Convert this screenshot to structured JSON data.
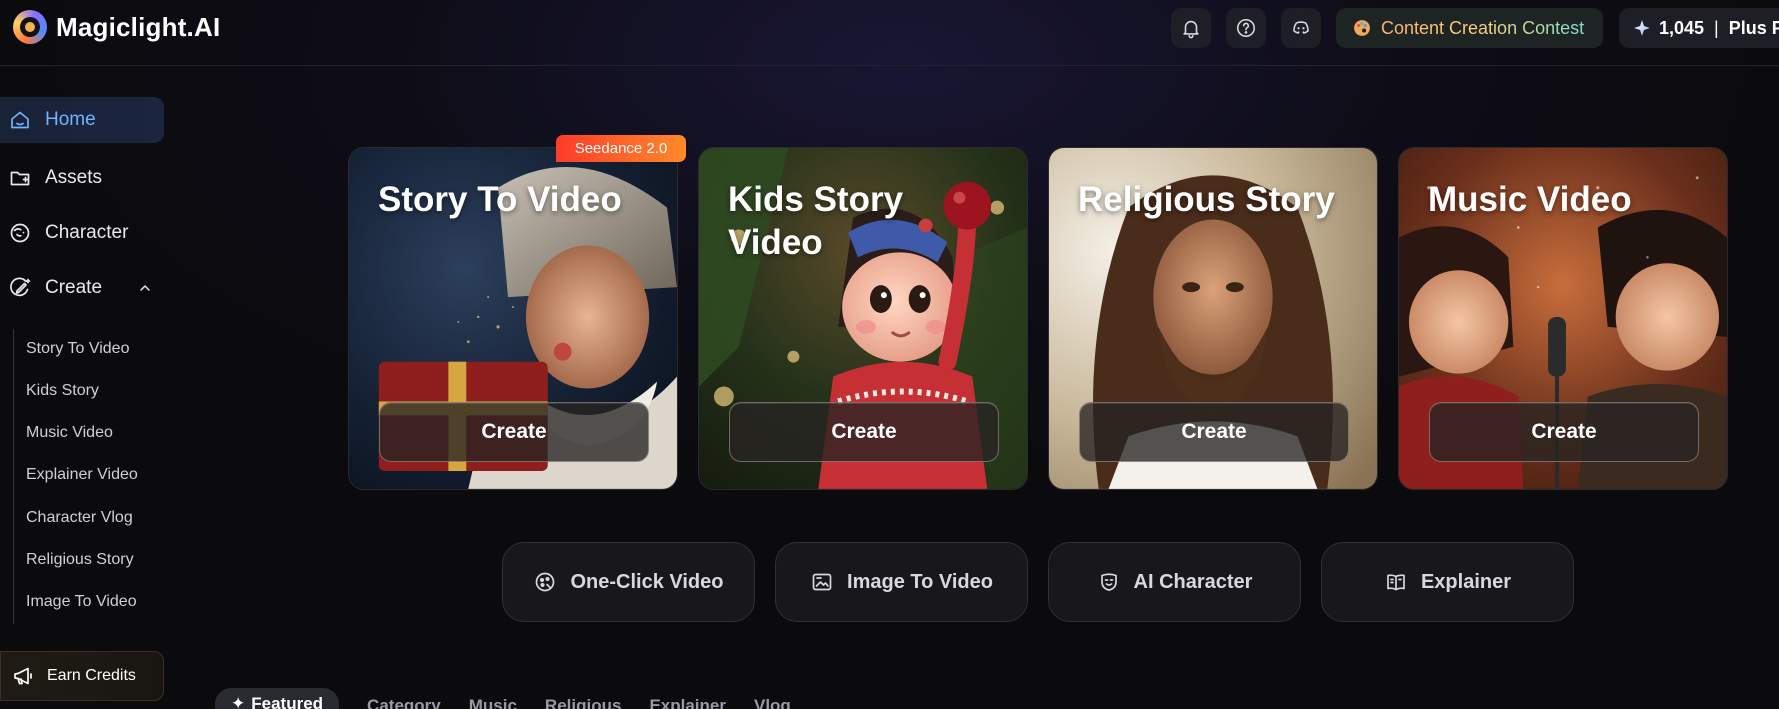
{
  "app": {
    "name": "Magiclight.AI"
  },
  "header": {
    "contest_label": "Content Creation Contest",
    "credits_value": "1,045",
    "credits_separator": "|",
    "plan_label": "Plus Pl"
  },
  "sidebar": {
    "items": [
      {
        "label": "Home",
        "icon": "home-icon",
        "active": true
      },
      {
        "label": "Assets",
        "icon": "folder-icon"
      },
      {
        "label": "Character",
        "icon": "character-icon"
      },
      {
        "label": "Create",
        "icon": "create-icon",
        "expanded": true
      }
    ],
    "create_sub_items": [
      "Story To Video",
      "Kids Story",
      "Music Video",
      "Explainer Video",
      "Character Vlog",
      "Religious Story",
      "Image To Video"
    ],
    "earn_credits_label": "Earn Credits"
  },
  "cards": [
    {
      "title": "Story To Video",
      "button": "Create"
    },
    {
      "title": "Kids Story Video",
      "button": "Create"
    },
    {
      "title": "Religious Story",
      "button": "Create"
    },
    {
      "title": "Music Video",
      "button": "Create"
    }
  ],
  "badge": {
    "label": "Seedance 2.0"
  },
  "quick_actions": [
    {
      "label": "One-Click Video",
      "icon": "magic-icon"
    },
    {
      "label": "Image To Video",
      "icon": "image-icon"
    },
    {
      "label": "AI Character",
      "icon": "mask-icon"
    },
    {
      "label": "Explainer",
      "icon": "book-icon"
    }
  ],
  "tabs": [
    "Featured",
    "Category",
    "Music",
    "Religious",
    "Explainer",
    "Vlog"
  ],
  "colors": {
    "accent_blue": "#6fb3ff",
    "badge_red": "#ff3b2a",
    "badge_orange": "#ff8a2b"
  }
}
